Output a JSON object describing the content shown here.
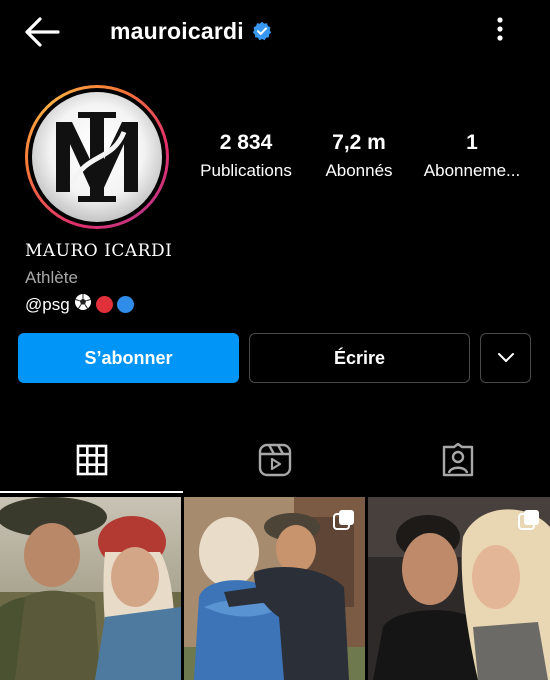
{
  "header": {
    "username": "mauroicardi"
  },
  "profile": {
    "full_name": "MAURO ICARDI",
    "category": "Athlète",
    "bio_text": "@psg",
    "bio_emojis": [
      "soccer-ball",
      "red-circle",
      "blue-circle"
    ],
    "logo_letters": "MI"
  },
  "stats": [
    {
      "value": "2 834",
      "label": "Publications"
    },
    {
      "value": "7,2 m",
      "label": "Abonnés"
    },
    {
      "value": "1",
      "label": "Abonneme..."
    }
  ],
  "actions": {
    "follow_label": "S’abonner",
    "message_label": "Écrire"
  },
  "tabs": [
    {
      "icon": "grid-icon",
      "active": true
    },
    {
      "icon": "reels-icon",
      "active": false
    },
    {
      "icon": "tagged-icon",
      "active": false
    }
  ],
  "colors": {
    "accent": "#0095f6",
    "verified": "#3897f0",
    "muted": "#a8a8a8"
  }
}
